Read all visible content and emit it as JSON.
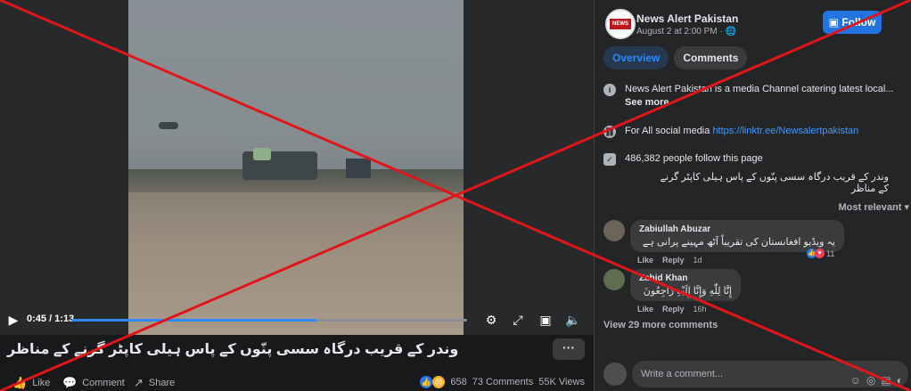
{
  "video": {
    "time": "0:45 / 1:13",
    "progress_fraction": 0.62,
    "caption": "وندر کے قریب درگاہ سسی پنّوں کے پاس ہیلی کاپٹر گرنے کے مناظر",
    "more_label": "···",
    "actions": {
      "like": "Like",
      "comment": "Comment",
      "share": "Share"
    },
    "stats": {
      "reactions": "658",
      "comments": "73 Comments",
      "views": "55K Views"
    }
  },
  "post": {
    "page_name": "News Alert Pakistan",
    "date": "August 2 at 2:00 PM · ",
    "follow_label": "Follow",
    "logo_text": "NEWS ALERT",
    "tabs": [
      "Overview",
      "Comments"
    ],
    "info": {
      "about": "News Alert Pakistan is a media Channel catering latest local...",
      "see_more": "See more",
      "social_prefix": "For All social media ",
      "social_link": "https://linktr.ee/Newsalertpakistan",
      "followers": "486,382 people follow this page"
    },
    "urdu_desc": "وندر کے قریب درگاہ سسی پنّوں کے پاس ہیلی کاپٹر گرنے کے مناظر",
    "sort_label": "Most relevant ▾"
  },
  "comments": [
    {
      "name": "Zabiullah Abuzar",
      "text": "یہ ویڈیو افغانستان کی تقریباً آٹھ مہینے پرانی ہے",
      "like": "Like",
      "reply": "Reply",
      "age": "1d",
      "reactions": "11"
    },
    {
      "name": "Zahid Khan",
      "text": "إِنَّا لِلّٰهِ وَإِنَّا إِلَيْهِ رَاجِعُونَ",
      "like": "Like",
      "reply": "Reply",
      "age": "16h"
    }
  ],
  "view_more": "View 29 more comments",
  "write_placeholder": "Write a comment...",
  "colors": {
    "accent": "#2374e1",
    "cross": "#e0161b"
  }
}
